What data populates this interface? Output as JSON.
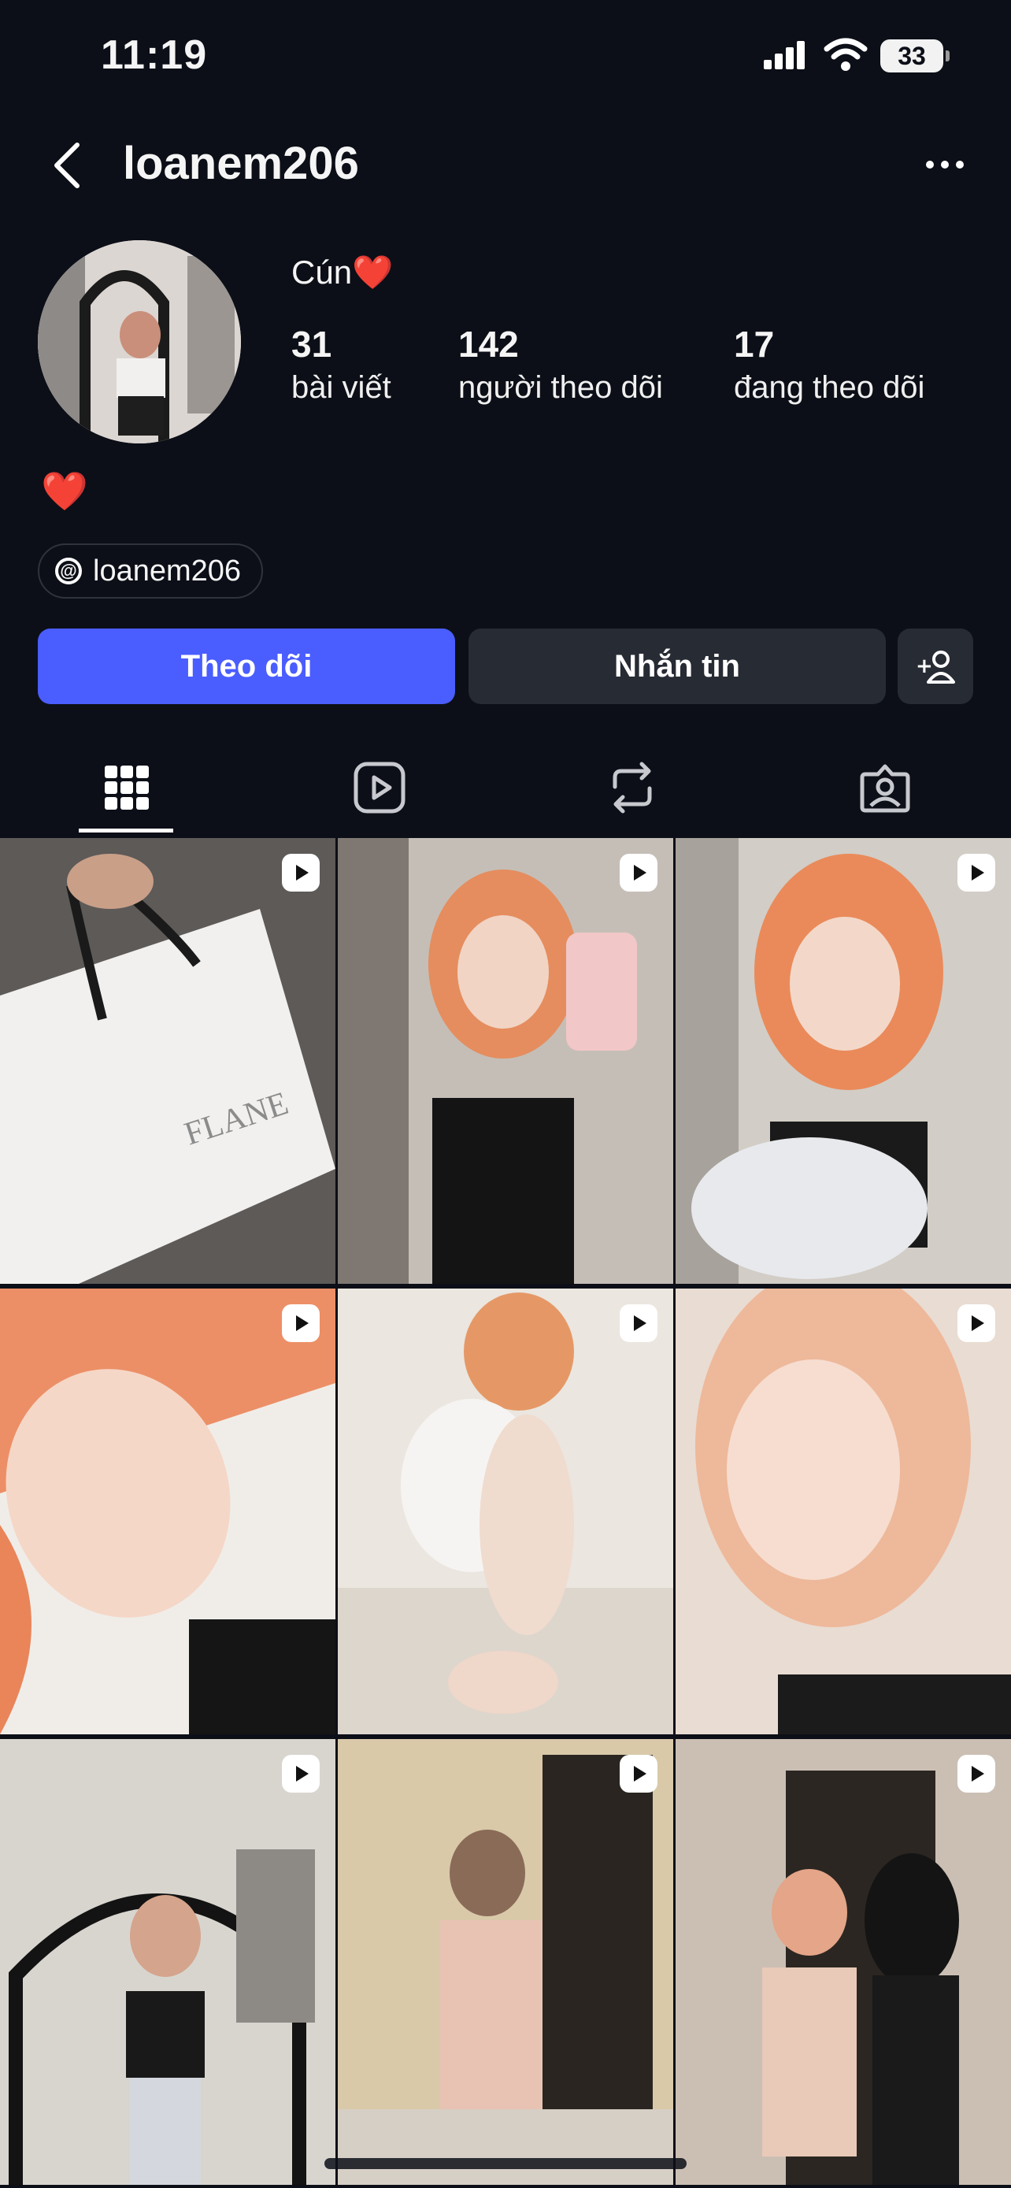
{
  "status_bar": {
    "time": "11:19",
    "battery": "33"
  },
  "header": {
    "username": "loanem206"
  },
  "profile": {
    "display_name": "Cún❤️",
    "stats": [
      {
        "number": "31",
        "label": "bài viết"
      },
      {
        "number": "142",
        "label": "người theo dõi"
      },
      {
        "number": "17",
        "label": "đang theo dõi"
      }
    ],
    "bio": "❤️",
    "threads_handle": "loanem206"
  },
  "actions": {
    "follow": "Theo dõi",
    "message": "Nhắn tin"
  },
  "tabs": [
    {
      "name": "grid-icon",
      "active": true
    },
    {
      "name": "reels-icon",
      "active": false
    },
    {
      "name": "reposts-icon",
      "active": false
    },
    {
      "name": "tagged-icon",
      "active": false
    }
  ],
  "posts": [
    {
      "type": "reel",
      "bg": "#dcdad6"
    },
    {
      "type": "reel",
      "bg": "#c9c2bd"
    },
    {
      "type": "reel",
      "bg": "#d4cfca"
    },
    {
      "type": "reel",
      "bg": "#d9b7a6"
    },
    {
      "type": "reel",
      "bg": "#e8e3dd"
    },
    {
      "type": "reel",
      "bg": "#e6d8cf"
    },
    {
      "type": "reel",
      "bg": "#d6d3cd"
    },
    {
      "type": "reel",
      "bg": "#d8c7a8"
    },
    {
      "type": "reel",
      "bg": "#cfc4b8"
    }
  ]
}
